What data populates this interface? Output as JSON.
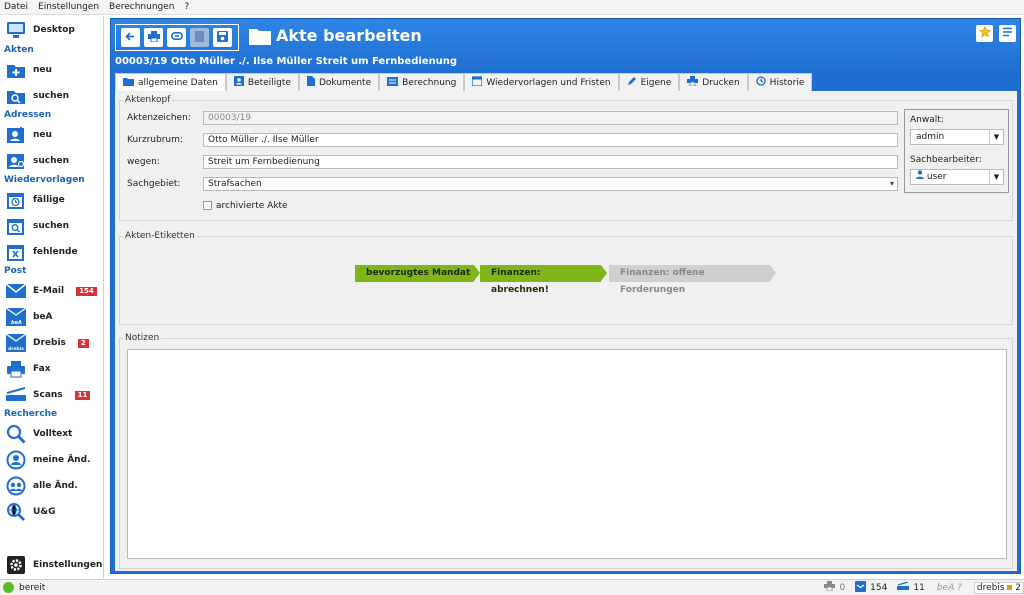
{
  "menubar": [
    "Datei",
    "Einstellungen",
    "Berechnungen",
    "?"
  ],
  "sidebar": {
    "desktop": "Desktop",
    "akten_header": "Akten",
    "akten_neu": "neu",
    "akten_suchen": "suchen",
    "adressen_header": "Adressen",
    "adressen_neu": "neu",
    "adressen_suchen": "suchen",
    "wiedervorlagen_header": "Wiedervorlagen",
    "wv_faellige": "fällige",
    "wv_suchen": "suchen",
    "wv_fehlende": "fehlende",
    "post_header": "Post",
    "email": "E-Mail",
    "email_count": "154",
    "bea": "beA",
    "drebis": "Drebis",
    "drebis_count": "2",
    "fax": "Fax",
    "scans": "Scans",
    "scans_count": "11",
    "recherche_header": "Recherche",
    "volltext": "Volltext",
    "meine_aend": "meine Änd.",
    "alle_aend": "alle Änd.",
    "ug": "U&G",
    "einstellungen": "Einstellungen"
  },
  "header": {
    "title": "Akte bearbeiten",
    "subtitle": "00003/19 Otto Müller ./. Ilse Müller Streit um Fernbedienung"
  },
  "tabs": [
    {
      "label": "allgemeine Daten",
      "icon": "folder-icon"
    },
    {
      "label": "Beteiligte",
      "icon": "contact-icon"
    },
    {
      "label": "Dokumente",
      "icon": "document-icon"
    },
    {
      "label": "Berechnung",
      "icon": "calculator-icon"
    },
    {
      "label": "Wiedervorlagen und Fristen",
      "icon": "calendar-icon"
    },
    {
      "label": "Eigene",
      "icon": "pencil-icon"
    },
    {
      "label": "Drucken",
      "icon": "printer-icon"
    },
    {
      "label": "Historie",
      "icon": "history-icon"
    }
  ],
  "aktenkopf": {
    "legend": "Aktenkopf",
    "aktenzeichen_label": "Aktenzeichen:",
    "aktenzeichen_value": "00003/19",
    "kurzrubrum_label": "Kurzrubrum:",
    "kurzrubrum_value": "Otto Müller ./. Ilse Müller",
    "wegen_label": "wegen:",
    "wegen_value": "Streit um Fernbedienung",
    "sachgebiet_label": "Sachgebiet:",
    "sachgebiet_value": "Strafsachen",
    "archiviert_label": "archivierte Akte",
    "anwalt_label": "Anwalt:",
    "anwalt_value": "admin",
    "sachbearbeiter_label": "Sachbearbeiter:",
    "sachbearbeiter_value": "user"
  },
  "etiketten": {
    "legend": "Akten-Etiketten",
    "tags": [
      {
        "label": "bevorzugtes Mandat",
        "active": true
      },
      {
        "label": "Finanzen: abrechnen!",
        "active": true
      },
      {
        "label": "Finanzen: offene Forderungen",
        "active": false
      }
    ]
  },
  "notizen": {
    "legend": "Notizen"
  },
  "statusbar": {
    "status": "bereit",
    "print_count": "0",
    "mail_count": "154",
    "scan_count": "11",
    "bea": "beA ?",
    "drebis": "drebis",
    "drebis_count": "2"
  },
  "colors": {
    "accent": "#1f6fd0",
    "tag_green": "#7fb519",
    "badge_red": "#d9333a",
    "status_green": "#5cb82a"
  }
}
